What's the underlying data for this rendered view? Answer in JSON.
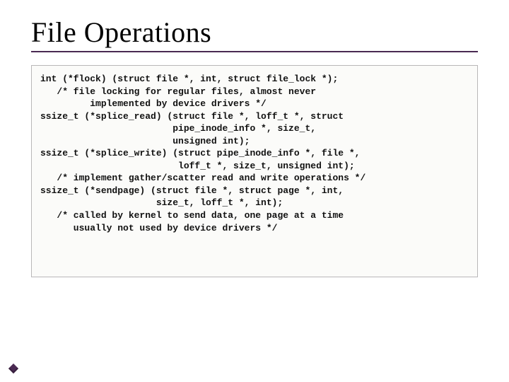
{
  "slide": {
    "title": "File Operations",
    "code": "int (*flock) (struct file *, int, struct file_lock *);\n   /* file locking for regular files, almost never\n         implemented by device drivers */\nssize_t (*splice_read) (struct file *, loff_t *, struct\n                        pipe_inode_info *, size_t,\n                        unsigned int);\nssize_t (*splice_write) (struct pipe_inode_info *, file *,\n                         loff_t *, size_t, unsigned int);\n   /* implement gather/scatter read and write operations */\nssize_t (*sendpage) (struct file *, struct page *, int,\n                     size_t, loff_t *, int);\n   /* called by kernel to send data, one page at a time\n      usually not used by device drivers */"
  }
}
